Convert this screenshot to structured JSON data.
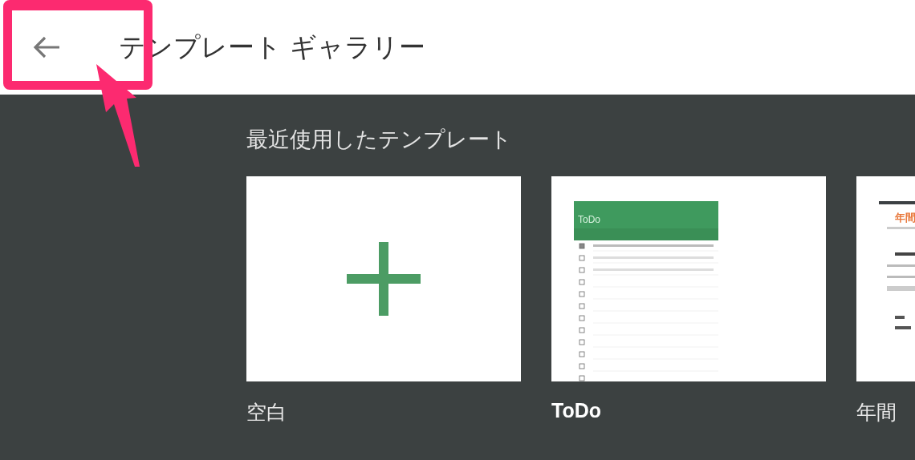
{
  "header": {
    "title": "テンプレート ギャラリー"
  },
  "section": {
    "title": "最近使用したテンプレート"
  },
  "templates": [
    {
      "kind": "blank",
      "label": "空白",
      "selected": false
    },
    {
      "kind": "todo",
      "label": "ToDo",
      "selected": true,
      "preview_title": "ToDo",
      "rows": [
        {
          "checked": true
        },
        {
          "checked": false
        },
        {
          "checked": false
        },
        {
          "checked": false
        },
        {
          "checked": false
        },
        {
          "checked": false
        },
        {
          "checked": false
        },
        {
          "checked": false
        },
        {
          "checked": false
        },
        {
          "checked": false
        },
        {
          "checked": false
        },
        {
          "checked": false
        }
      ]
    },
    {
      "kind": "doc",
      "label": "年間",
      "selected": false,
      "preview_title": "年間"
    }
  ]
}
